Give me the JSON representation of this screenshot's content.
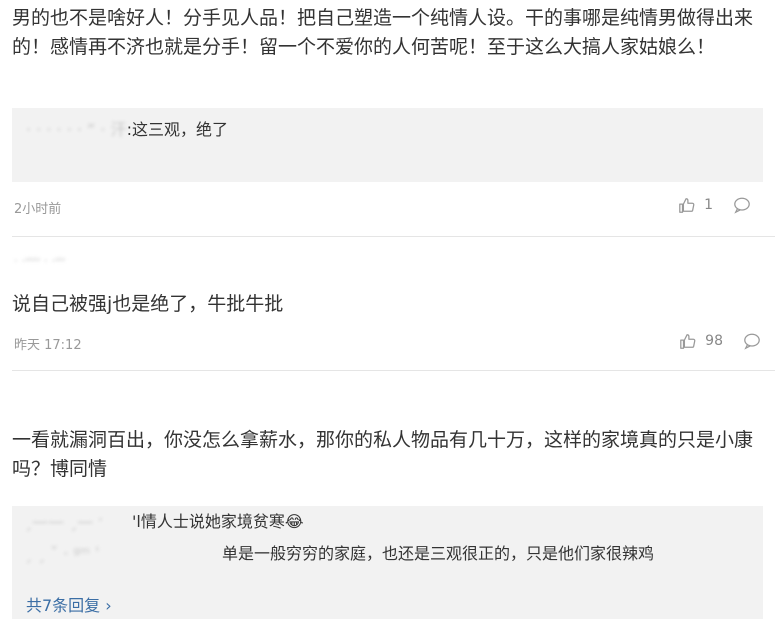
{
  "comments": [
    {
      "text": "男的也不是啥好人！分手见人品！把自己塑造一个纯情人设。干的事哪是纯情男做得出来的！感情再不济也就是分手！留一个不爱你的人何苦呢！至于这么大搞人家姑娘么！",
      "reply": {
        "author": "· · · · · ·  “ · 汗",
        "text": ":这三观，绝了"
      },
      "time": "2小时前",
      "likes": "1"
    },
    {
      "author_blur": "· ·ᵘᵘᵘ  · ·ᵘᵘ",
      "text": "说自己被强j也是绝了，牛批牛批",
      "time": "昨天 17:12",
      "likes": "98"
    },
    {
      "text": "一看就漏洞百出，你没怎么拿薪水，那你的私人物品有几十万，这样的家境真的只是小康吗？博同情",
      "replies": [
        {
          "author": "ˏ——  ˏ—  ˑ",
          "text": "'l情人士说她家境贫寒😂"
        },
        {
          "author": "ˏ           ˏ ˇ  ·   ᵍᵐ ˈ",
          "text": "单是一般穷穷的家庭，也还是三观很正的，只是他们家很辣鸡"
        }
      ],
      "more_label": "共7条回复"
    }
  ]
}
